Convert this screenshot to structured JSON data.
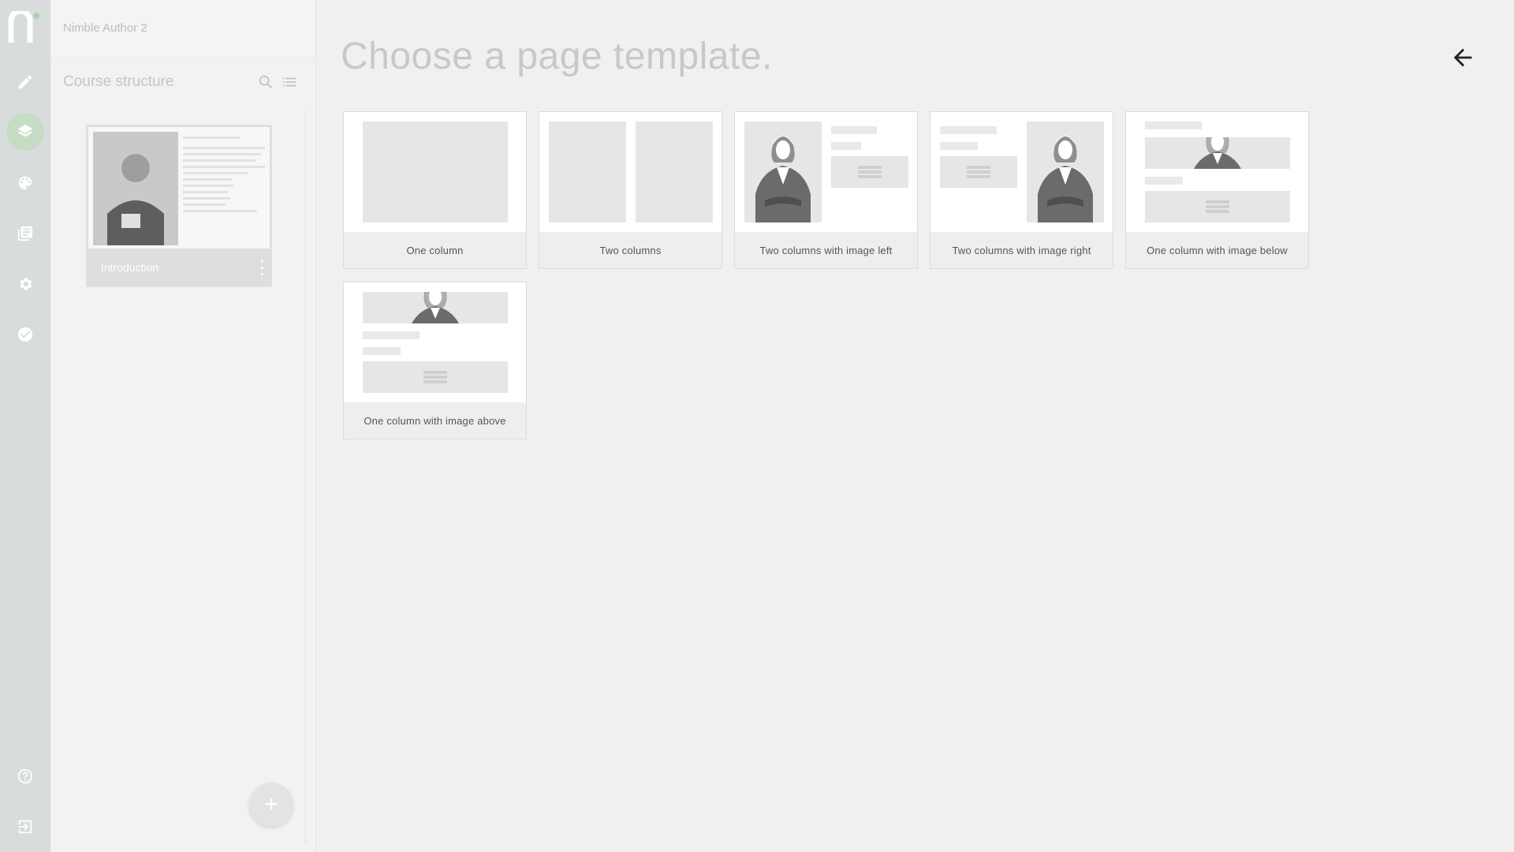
{
  "app": {
    "name": "Nimble Author 2"
  },
  "rail": {
    "items": [
      {
        "name": "edit-icon"
      },
      {
        "name": "layers-icon",
        "active": true
      },
      {
        "name": "palette-icon"
      },
      {
        "name": "library-icon"
      },
      {
        "name": "gear-icon"
      },
      {
        "name": "check-circle-icon"
      },
      {
        "name": "help-icon"
      },
      {
        "name": "exit-icon"
      }
    ]
  },
  "panel": {
    "title": "Course structure",
    "pages": [
      {
        "label": "Introduction"
      }
    ],
    "add_label": "+"
  },
  "main": {
    "title": "Choose a page template.",
    "templates": [
      {
        "label": "One column"
      },
      {
        "label": "Two columns"
      },
      {
        "label": "Two columns with image left"
      },
      {
        "label": "Two columns with image right"
      },
      {
        "label": "One column with image below"
      },
      {
        "label": "One column with image above"
      }
    ]
  },
  "colors": {
    "rail_bg": "#d9dcdc",
    "active_item": "#c5ddc5",
    "accent_green": "#a8d5a8"
  }
}
